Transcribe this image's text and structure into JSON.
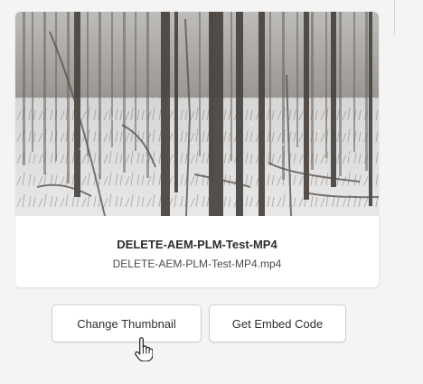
{
  "asset_card": {
    "title": "DELETE-AEM-PLM-Test-MP4",
    "filename": "DELETE-AEM-PLM-Test-MP4.mp4",
    "thumbnail_alt": "snowy forest video thumbnail"
  },
  "actions": {
    "change_thumbnail": "Change Thumbnail",
    "get_embed_code": "Get Embed Code"
  },
  "icons": {
    "cursor": "hand-pointer-icon"
  }
}
